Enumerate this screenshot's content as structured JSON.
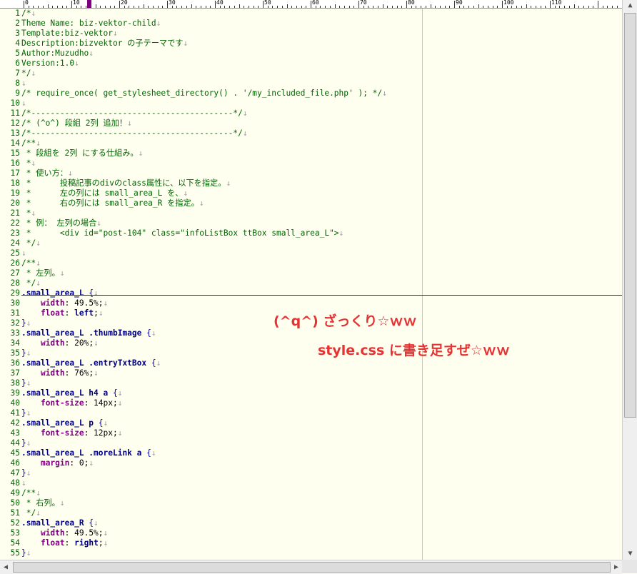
{
  "ruler": {
    "labels": [
      "0",
      "10",
      "20",
      "30",
      "40",
      "50",
      "60",
      "70",
      "80",
      "90",
      "100",
      "110"
    ]
  },
  "lines": [
    {
      "n": "1",
      "s": [
        [
          "/*",
          "cmt"
        ],
        [
          "↓",
          "eol"
        ]
      ]
    },
    {
      "n": "2",
      "s": [
        [
          "Theme Name: biz-vektor-child",
          "cmt"
        ],
        [
          "↓",
          "eol"
        ]
      ]
    },
    {
      "n": "3",
      "s": [
        [
          "Template:biz-vektor",
          "cmt"
        ],
        [
          "↓",
          "eol"
        ]
      ]
    },
    {
      "n": "4",
      "s": [
        [
          "Description:bizvektor の子テーマです",
          "cmt"
        ],
        [
          "↓",
          "eol"
        ]
      ]
    },
    {
      "n": "5",
      "s": [
        [
          "Author:Muzudho",
          "cmt"
        ],
        [
          "↓",
          "eol"
        ]
      ]
    },
    {
      "n": "6",
      "s": [
        [
          "Version:1.0",
          "cmt"
        ],
        [
          "↓",
          "eol"
        ]
      ]
    },
    {
      "n": "7",
      "s": [
        [
          "*/",
          "cmt"
        ],
        [
          "↓",
          "eol"
        ]
      ]
    },
    {
      "n": "8",
      "s": [
        [
          "↓",
          "eol"
        ]
      ]
    },
    {
      "n": "9",
      "s": [
        [
          "/* require_once( get_stylesheet_directory() . '/my_included_file.php' ); */",
          "cmt"
        ],
        [
          "↓",
          "eol"
        ]
      ]
    },
    {
      "n": "10",
      "s": [
        [
          "↓",
          "eol"
        ]
      ]
    },
    {
      "n": "11",
      "s": [
        [
          "/*------------------------------------------*/",
          "cmt"
        ],
        [
          "↓",
          "eol"
        ]
      ]
    },
    {
      "n": "12",
      "s": [
        [
          "/* (^o^) 段組 2列 追加！",
          "cmt"
        ],
        [
          "↓",
          "eol"
        ]
      ]
    },
    {
      "n": "13",
      "s": [
        [
          "/*------------------------------------------*/",
          "cmt"
        ],
        [
          "↓",
          "eol"
        ]
      ]
    },
    {
      "n": "14",
      "s": [
        [
          "/**",
          "cmt"
        ],
        [
          "↓",
          "eol"
        ]
      ]
    },
    {
      "n": "15",
      "s": [
        [
          " * 段組を 2列 にする仕組み。",
          "cmt"
        ],
        [
          "↓",
          "eol"
        ]
      ]
    },
    {
      "n": "16",
      "s": [
        [
          " *",
          "cmt"
        ],
        [
          "↓",
          "eol"
        ]
      ]
    },
    {
      "n": "17",
      "s": [
        [
          " * 使い方：",
          "cmt"
        ],
        [
          "↓",
          "eol"
        ]
      ]
    },
    {
      "n": "18",
      "s": [
        [
          " *      投稿記事のdivのclass属性に、以下を指定。",
          "cmt"
        ],
        [
          "↓",
          "eol"
        ]
      ]
    },
    {
      "n": "19",
      "s": [
        [
          " *      左の列には small_area_L を、",
          "cmt"
        ],
        [
          "↓",
          "eol"
        ]
      ]
    },
    {
      "n": "20",
      "s": [
        [
          " *      右の列には small_area_R を指定。",
          "cmt"
        ],
        [
          "↓",
          "eol"
        ]
      ]
    },
    {
      "n": "21",
      "s": [
        [
          " *",
          "cmt"
        ],
        [
          "↓",
          "eol"
        ]
      ]
    },
    {
      "n": "22",
      "s": [
        [
          " * 例： 左列の場合",
          "cmt"
        ],
        [
          "↓",
          "eol"
        ]
      ]
    },
    {
      "n": "23",
      "s": [
        [
          " *      <div id=\"post-104\" class=\"infoListBox ttBox small_area_L\">",
          "cmt"
        ],
        [
          "↓",
          "eol"
        ]
      ]
    },
    {
      "n": "24",
      "s": [
        [
          " */",
          "cmt"
        ],
        [
          "↓",
          "eol"
        ]
      ]
    },
    {
      "n": "25",
      "s": [
        [
          "↓",
          "eol"
        ]
      ]
    },
    {
      "n": "26",
      "s": [
        [
          "/**",
          "cmt"
        ],
        [
          "↓",
          "eol"
        ]
      ]
    },
    {
      "n": "27",
      "s": [
        [
          " * 左列。",
          "cmt"
        ],
        [
          "↓",
          "eol"
        ]
      ]
    },
    {
      "n": "28",
      "s": [
        [
          " */",
          "cmt"
        ],
        [
          "↓",
          "eol"
        ]
      ]
    },
    {
      "n": "29",
      "s": [
        [
          ".small_area_L ",
          "kw"
        ],
        [
          "{",
          "brace"
        ],
        [
          "↓",
          "eol"
        ]
      ]
    },
    {
      "n": "30",
      "s": [
        [
          "    ",
          "val"
        ],
        [
          "width",
          "prop"
        ],
        [
          ": 49.5%;",
          "val"
        ],
        [
          "↓",
          "eol"
        ]
      ]
    },
    {
      "n": "31",
      "s": [
        [
          "    ",
          "val"
        ],
        [
          "float",
          "prop"
        ],
        [
          ": ",
          "val"
        ],
        [
          "left",
          "kw"
        ],
        [
          ";",
          "val"
        ],
        [
          "↓",
          "eol"
        ]
      ]
    },
    {
      "n": "32",
      "s": [
        [
          "}",
          "brace"
        ],
        [
          "↓",
          "eol"
        ]
      ]
    },
    {
      "n": "33",
      "s": [
        [
          ".small_area_L .thumbImage ",
          "kw"
        ],
        [
          "{",
          "brace"
        ],
        [
          "↓",
          "eol"
        ]
      ]
    },
    {
      "n": "34",
      "s": [
        [
          "    ",
          "val"
        ],
        [
          "width",
          "prop"
        ],
        [
          ": 20%;",
          "val"
        ],
        [
          "↓",
          "eol"
        ]
      ]
    },
    {
      "n": "35",
      "s": [
        [
          "}",
          "brace"
        ],
        [
          "↓",
          "eol"
        ]
      ]
    },
    {
      "n": "36",
      "s": [
        [
          ".small_area_L .entryTxtBox ",
          "kw"
        ],
        [
          "{",
          "brace"
        ],
        [
          "↓",
          "eol"
        ]
      ]
    },
    {
      "n": "37",
      "s": [
        [
          "    ",
          "val"
        ],
        [
          "width",
          "prop"
        ],
        [
          ": 76%;",
          "val"
        ],
        [
          "↓",
          "eol"
        ]
      ]
    },
    {
      "n": "38",
      "s": [
        [
          "}",
          "brace"
        ],
        [
          "↓",
          "eol"
        ]
      ]
    },
    {
      "n": "39",
      "s": [
        [
          ".small_area_L h4 a ",
          "kw"
        ],
        [
          "{",
          "brace"
        ],
        [
          "↓",
          "eol"
        ]
      ]
    },
    {
      "n": "40",
      "s": [
        [
          "    ",
          "val"
        ],
        [
          "font-size",
          "prop"
        ],
        [
          ": 14px;",
          "val"
        ],
        [
          "↓",
          "eol"
        ]
      ]
    },
    {
      "n": "41",
      "s": [
        [
          "}",
          "brace"
        ],
        [
          "↓",
          "eol"
        ]
      ]
    },
    {
      "n": "42",
      "s": [
        [
          ".small_area_L p ",
          "kw"
        ],
        [
          "{",
          "brace"
        ],
        [
          "↓",
          "eol"
        ]
      ]
    },
    {
      "n": "43",
      "s": [
        [
          "    ",
          "val"
        ],
        [
          "font-size",
          "prop"
        ],
        [
          ": 12px;",
          "val"
        ],
        [
          "↓",
          "eol"
        ]
      ]
    },
    {
      "n": "44",
      "s": [
        [
          "}",
          "brace"
        ],
        [
          "↓",
          "eol"
        ]
      ]
    },
    {
      "n": "45",
      "s": [
        [
          ".small_area_L .moreLink a ",
          "kw"
        ],
        [
          "{",
          "brace"
        ],
        [
          "↓",
          "eol"
        ]
      ]
    },
    {
      "n": "46",
      "s": [
        [
          "    ",
          "val"
        ],
        [
          "margin",
          "prop"
        ],
        [
          ": 0;",
          "val"
        ],
        [
          "↓",
          "eol"
        ]
      ]
    },
    {
      "n": "47",
      "s": [
        [
          "}",
          "brace"
        ],
        [
          "↓",
          "eol"
        ]
      ]
    },
    {
      "n": "48",
      "s": [
        [
          "↓",
          "eol"
        ]
      ]
    },
    {
      "n": "49",
      "s": [
        [
          "/**",
          "cmt"
        ],
        [
          "↓",
          "eol"
        ]
      ]
    },
    {
      "n": "50",
      "s": [
        [
          " * 右列。",
          "cmt"
        ],
        [
          "↓",
          "eol"
        ]
      ]
    },
    {
      "n": "51",
      "s": [
        [
          " */",
          "cmt"
        ],
        [
          "↓",
          "eol"
        ]
      ]
    },
    {
      "n": "52",
      "s": [
        [
          ".small_area_R ",
          "kw"
        ],
        [
          "{",
          "brace"
        ],
        [
          "↓",
          "eol"
        ]
      ]
    },
    {
      "n": "53",
      "s": [
        [
          "    ",
          "val"
        ],
        [
          "width",
          "prop"
        ],
        [
          ": 49.5%;",
          "val"
        ],
        [
          "↓",
          "eol"
        ]
      ]
    },
    {
      "n": "54",
      "s": [
        [
          "    ",
          "val"
        ],
        [
          "float",
          "prop"
        ],
        [
          ": ",
          "val"
        ],
        [
          "right",
          "kw"
        ],
        [
          ";",
          "val"
        ],
        [
          "↓",
          "eol"
        ]
      ]
    },
    {
      "n": "55",
      "s": [
        [
          "}",
          "brace"
        ],
        [
          "↓",
          "eol"
        ]
      ]
    }
  ],
  "overlay": {
    "line1": "(^q^) ざっくり☆ｗｗ",
    "line2": "style.css に書き足すぜ☆ｗｗ",
    "color": "#e53333"
  },
  "scroll": {
    "up_icon": "▲",
    "down_icon": "▼",
    "left_icon": "◀",
    "right_icon": "▶"
  }
}
